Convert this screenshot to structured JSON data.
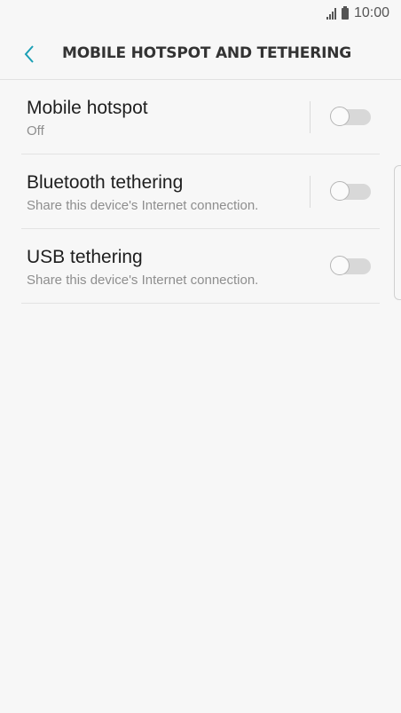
{
  "status_bar": {
    "time": "10:00",
    "icons": [
      "signal-icon",
      "battery-icon"
    ]
  },
  "header": {
    "back_icon": "chevron-left-icon",
    "title": "MOBILE HOTSPOT AND TETHERING",
    "accent_color": "#1a9fb5"
  },
  "settings": {
    "items": [
      {
        "title": "Mobile hotspot",
        "subtitle": "Off",
        "enabled": false
      },
      {
        "title": "Bluetooth tethering",
        "subtitle": "Share this device's Internet connection.",
        "enabled": false
      },
      {
        "title": "USB tethering",
        "subtitle": "Share this device's Internet connection.",
        "enabled": false
      }
    ]
  }
}
